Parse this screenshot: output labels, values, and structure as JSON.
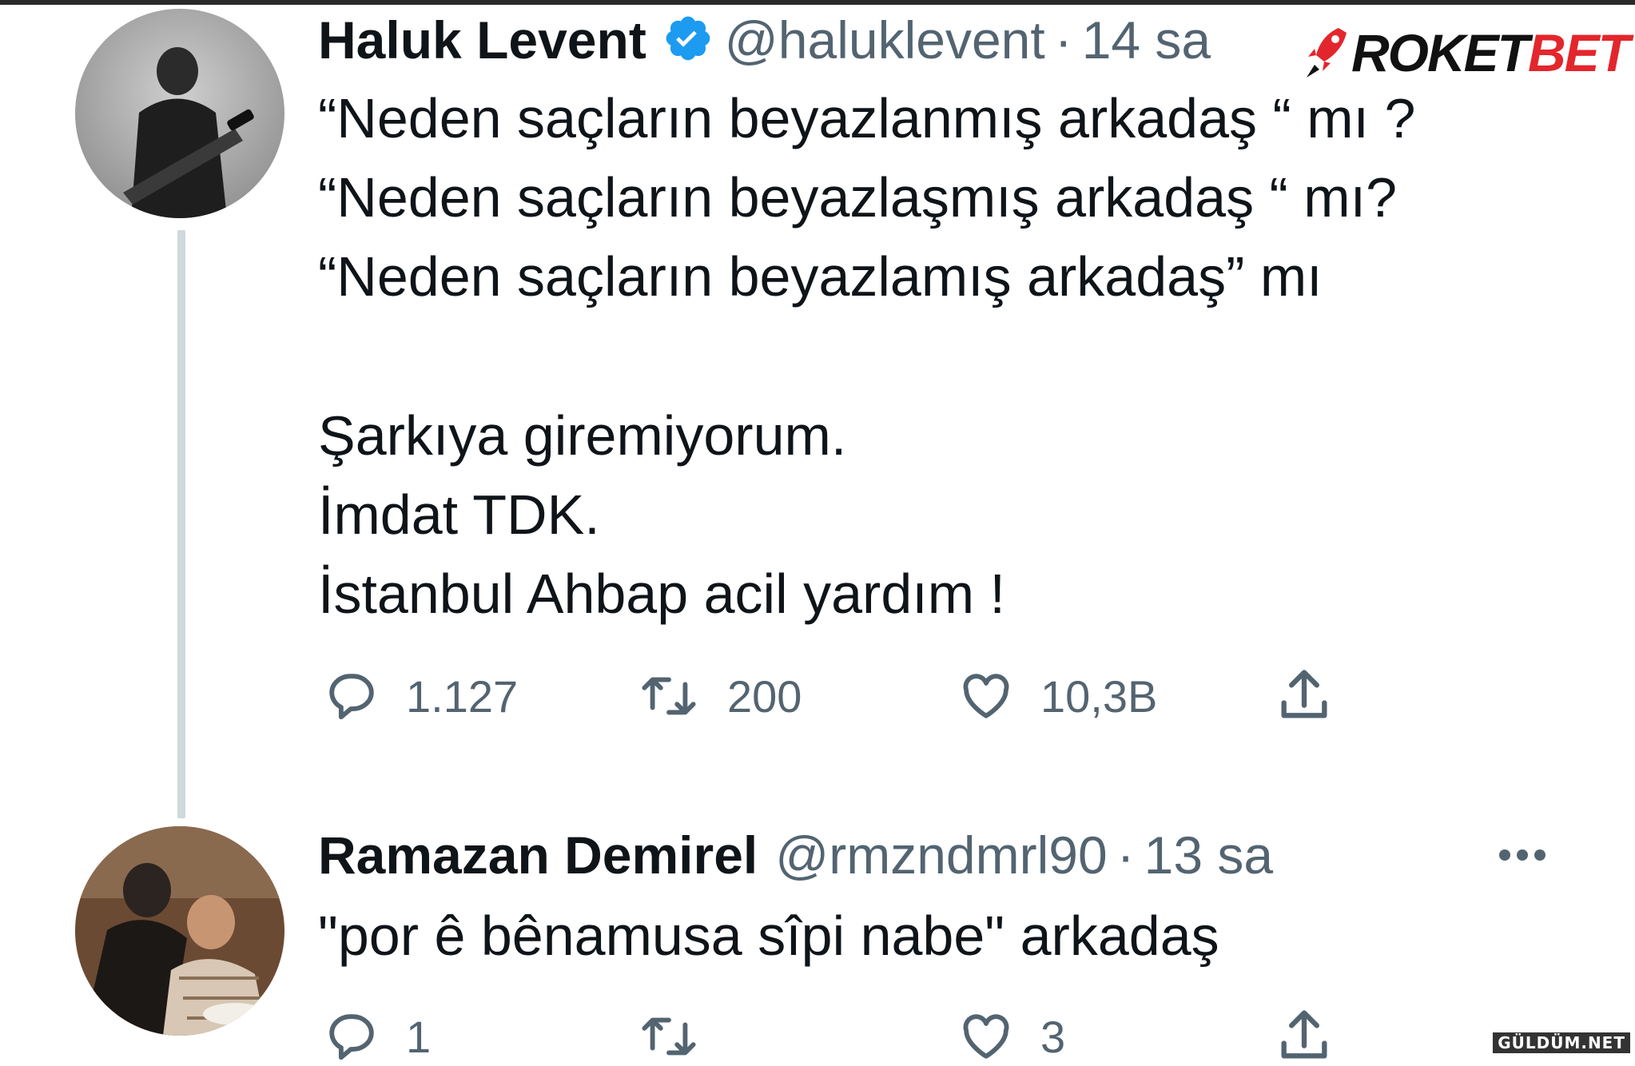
{
  "brand": {
    "logo_part1": "ROKET",
    "logo_part2": "BET",
    "watermark": "GÜLDÜM.NET"
  },
  "colors": {
    "text": "#0f1419",
    "muted": "#536471",
    "verified": "#1d9bf0",
    "thread_line": "#cfd9de",
    "brand_red": "#e3262c"
  },
  "tweets": [
    {
      "display_name": "Haluk Levent",
      "verified": true,
      "handle": "@haluklevent",
      "separator": "·",
      "time": "14 sa",
      "lines": [
        "“Neden saçların beyazlanmış arkadaş “ mı ?",
        "“Neden saçların beyazlaşmış arkadaş “ mı?",
        "“Neden saçların beyazlamış arkadaş” mı",
        "",
        "Şarkıya giremiyorum.",
        "İmdat TDK.",
        "İstanbul Ahbap acil yardım !"
      ],
      "replies": "1.127",
      "retweets": "200",
      "likes": "10,3B",
      "icons": [
        "reply-icon",
        "retweet-icon",
        "like-icon",
        "share-icon"
      ]
    },
    {
      "display_name": "Ramazan Demirel",
      "verified": false,
      "handle": "@rmzndmrl90",
      "separator": "·",
      "time": "13 sa",
      "lines": [
        "\"por ê bênamusa sîpi nabe\"  arkadaş"
      ],
      "replies": "1",
      "retweets": "",
      "likes": "3",
      "icons": [
        "reply-icon",
        "retweet-icon",
        "like-icon",
        "share-icon",
        "more-icon"
      ]
    }
  ]
}
